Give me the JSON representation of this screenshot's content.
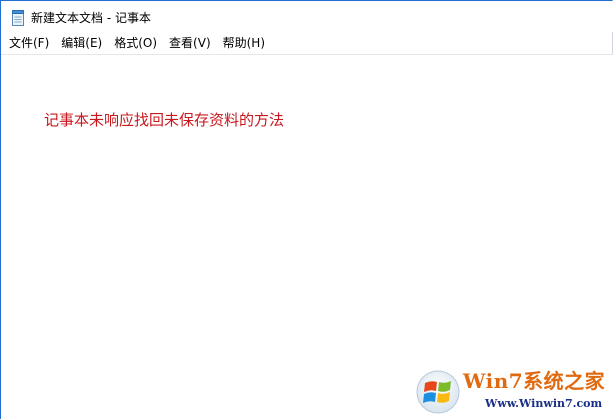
{
  "window": {
    "title": "新建文本文档 - 记事本",
    "icon": "notepad-icon"
  },
  "menu": {
    "items": [
      {
        "label": "文件(F)"
      },
      {
        "label": "编辑(E)"
      },
      {
        "label": "格式(O)"
      },
      {
        "label": "查看(V)"
      },
      {
        "label": "帮助(H)"
      }
    ]
  },
  "editor": {
    "content": "记事本未响应找回未保存资料的方法",
    "text_color": "#c8181e"
  },
  "watermark": {
    "brand": "Win7系统之家",
    "url": "Www.Winwin7.com",
    "brand_color": "#e06a10",
    "url_color": "#1a2f86"
  }
}
